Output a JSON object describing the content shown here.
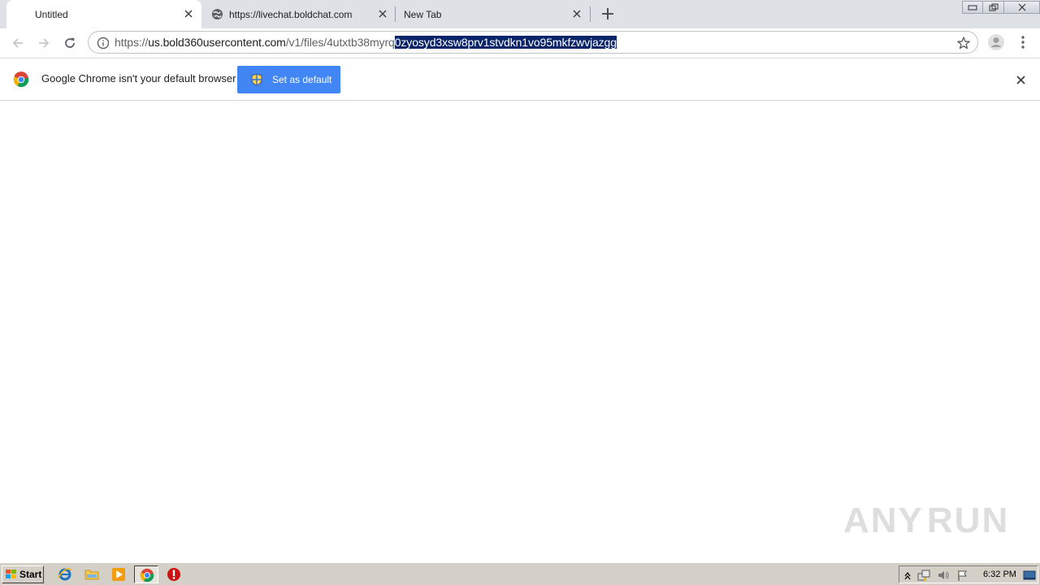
{
  "tabs": [
    {
      "title": "Untitled",
      "active": true
    },
    {
      "title": "https://livechat.boldchat.com",
      "active": false,
      "icon": "globe-icon"
    },
    {
      "title": "New Tab",
      "active": false
    }
  ],
  "address_bar": {
    "url_prefix": "https://",
    "url_host": "us.bold360usercontent.com",
    "url_path": "/v1/files/4utxtb38myrq",
    "url_selected": "0zyosyd3xsw8prv1stvdkn1vo95mkfzwvjazgg"
  },
  "infobar": {
    "message": "Google Chrome isn't your default browser",
    "button_label": "Set as default"
  },
  "watermark": {
    "left": "ANY",
    "right": "RUN"
  },
  "taskbar": {
    "start_label": "Start",
    "clock": "6:32 PM",
    "apps": [
      "internet-explorer-icon",
      "file-explorer-icon",
      "media-player-icon",
      "chrome-icon",
      "stop-icon"
    ]
  },
  "colors": {
    "accent_blue": "#4285f4",
    "selection": "#0a246a",
    "tabstrip": "#dee1e6",
    "taskbar": "#d4d0c8"
  }
}
